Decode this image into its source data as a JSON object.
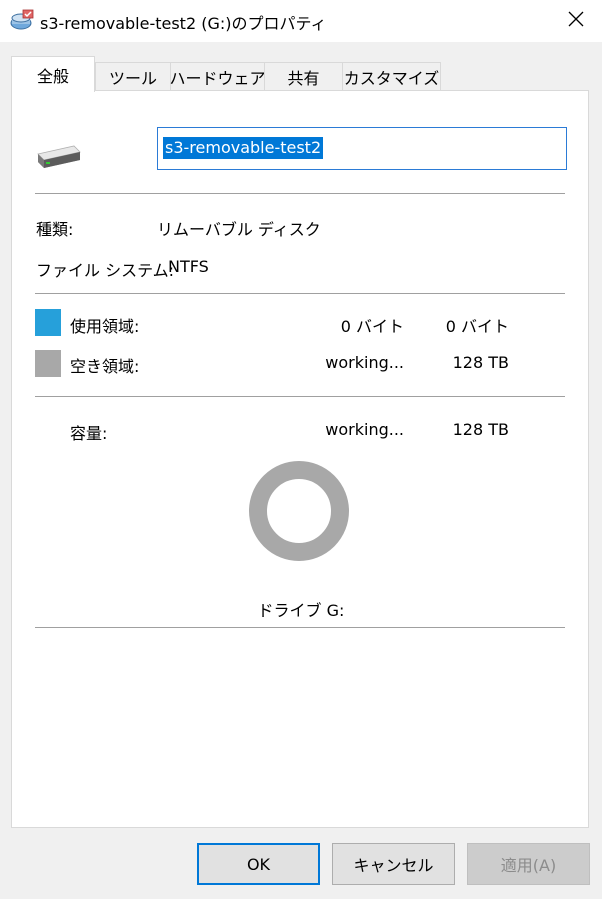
{
  "window": {
    "title": "s3-removable-test2 (G:)のプロパティ"
  },
  "tabs": [
    {
      "label": "全般",
      "active": true
    },
    {
      "label": "ツール",
      "active": false
    },
    {
      "label": "ハードウェア",
      "active": false
    },
    {
      "label": "共有",
      "active": false
    },
    {
      "label": "カスタマイズ",
      "active": false
    }
  ],
  "general": {
    "drive_name": "s3-removable-test2",
    "type_label": "種類:",
    "type_value": "リムーバブル ディスク",
    "fs_label": "ファイル システム:",
    "fs_value": "NTFS",
    "used_label": "使用領域:",
    "used_bytes": "0 バイト",
    "used_size": "0 バイト",
    "free_label": "空き領域:",
    "free_bytes": "working...",
    "free_size": "128 TB",
    "capacity_label": "容量:",
    "capacity_bytes": "working...",
    "capacity_size": "128 TB",
    "drive_label": "ドライブ G:",
    "used_color": "#26a0da",
    "free_color": "#a8a8a8",
    "used_fraction": 0
  },
  "buttons": {
    "ok": "OK",
    "cancel": "キャンセル",
    "apply": "適用(A)"
  },
  "icons": {
    "app": "drive-properties-icon",
    "close": "close-icon",
    "drive": "removable-drive-icon"
  }
}
